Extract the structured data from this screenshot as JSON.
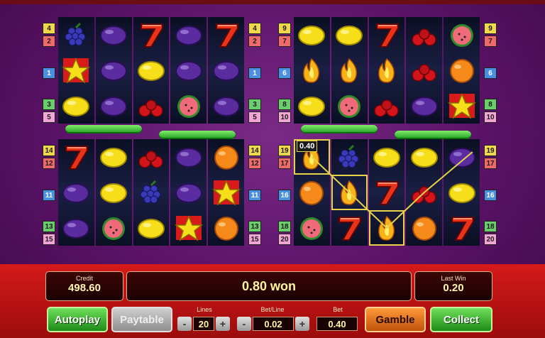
{
  "game": {
    "colors": {
      "background": "#5a1266",
      "bottom_bar": "#c81414",
      "accent_yellow": "#f2e29a"
    },
    "grids": [
      {
        "name": "top-left",
        "left_badges": [
          {
            "value": "4",
            "color": "#f1d84a"
          },
          {
            "value": "2",
            "color": "#f06a6a"
          },
          {
            "value": "1",
            "color": "#4a90e2"
          },
          {
            "value": "3",
            "color": "#6acf6a"
          },
          {
            "value": "5",
            "color": "#f3a6d6"
          }
        ],
        "right_badges": [
          {
            "value": "4",
            "color": "#f1d84a"
          },
          {
            "value": "2",
            "color": "#f06a6a"
          },
          {
            "value": "1",
            "color": "#4a90e2"
          },
          {
            "value": "3",
            "color": "#6acf6a"
          },
          {
            "value": "5",
            "color": "#f3a6d6"
          }
        ],
        "reels": [
          [
            "grapes",
            "star",
            "lemon"
          ],
          [
            "plum",
            "plum",
            "plum"
          ],
          [
            "seven",
            "lemon",
            "cherries"
          ],
          [
            "plum",
            "plum",
            "watermelon"
          ],
          [
            "seven",
            "plum",
            "plum"
          ]
        ]
      },
      {
        "name": "top-right",
        "left_badges": [
          {
            "value": "9",
            "color": "#f1d84a"
          },
          {
            "value": "7",
            "color": "#f06a6a"
          },
          {
            "value": "6",
            "color": "#4a90e2"
          },
          {
            "value": "8",
            "color": "#6acf6a"
          },
          {
            "value": "10",
            "color": "#f3a6d6"
          }
        ],
        "right_badges": [
          {
            "value": "9",
            "color": "#f1d84a"
          },
          {
            "value": "7",
            "color": "#f06a6a"
          },
          {
            "value": "6",
            "color": "#4a90e2"
          },
          {
            "value": "8",
            "color": "#6acf6a"
          },
          {
            "value": "10",
            "color": "#f3a6d6"
          }
        ],
        "reels": [
          [
            "lemon",
            "flame",
            "lemon"
          ],
          [
            "lemon",
            "flame",
            "watermelon"
          ],
          [
            "seven",
            "flame",
            "cherries"
          ],
          [
            "cherries",
            "cherries",
            "plum"
          ],
          [
            "watermelon",
            "orange",
            "star"
          ]
        ]
      },
      {
        "name": "bottom-left",
        "left_badges": [
          {
            "value": "14",
            "color": "#f1d84a"
          },
          {
            "value": "12",
            "color": "#f06a6a"
          },
          {
            "value": "11",
            "color": "#4a90e2"
          },
          {
            "value": "13",
            "color": "#6acf6a"
          },
          {
            "value": "15",
            "color": "#f3a6d6"
          }
        ],
        "right_badges": [
          {
            "value": "14",
            "color": "#f1d84a"
          },
          {
            "value": "12",
            "color": "#f06a6a"
          },
          {
            "value": "11",
            "color": "#4a90e2"
          },
          {
            "value": "13",
            "color": "#6acf6a"
          },
          {
            "value": "15",
            "color": "#f3a6d6"
          }
        ],
        "reels": [
          [
            "seven",
            "plum",
            "plum"
          ],
          [
            "lemon",
            "lemon",
            "watermelon"
          ],
          [
            "cherries",
            "grapes",
            "lemon"
          ],
          [
            "plum",
            "plum",
            "star"
          ],
          [
            "orange",
            "star",
            "orange"
          ]
        ]
      },
      {
        "name": "bottom-right",
        "left_badges": [
          {
            "value": "19",
            "color": "#f1d84a"
          },
          {
            "value": "17",
            "color": "#f06a6a"
          },
          {
            "value": "16",
            "color": "#4a90e2"
          },
          {
            "value": "18",
            "color": "#6acf6a"
          },
          {
            "value": "20",
            "color": "#f3a6d6"
          }
        ],
        "right_badges": [
          {
            "value": "19",
            "color": "#f1d84a"
          },
          {
            "value": "17",
            "color": "#f06a6a"
          },
          {
            "value": "16",
            "color": "#4a90e2"
          },
          {
            "value": "18",
            "color": "#6acf6a"
          },
          {
            "value": "20",
            "color": "#f3a6d6"
          }
        ],
        "reels": [
          [
            "flame",
            "orange",
            "watermelon"
          ],
          [
            "grapes",
            "flame",
            "seven"
          ],
          [
            "lemon",
            "seven",
            "flame"
          ],
          [
            "lemon",
            "cherries",
            "orange"
          ],
          [
            "plum",
            "lemon",
            "seven"
          ]
        ]
      }
    ],
    "win_label": "0.40"
  },
  "panel": {
    "credit_label": "Credit",
    "credit_value": "498.60",
    "message": "0.80 won",
    "last_win_label": "Last Win",
    "last_win_value": "0.20",
    "lines_label": "Lines",
    "lines_value": "20",
    "bet_line_label": "Bet/Line",
    "bet_line_value": "0.02",
    "bet_label": "Bet",
    "bet_value": "0.40",
    "minus": "-",
    "plus": "+",
    "autoplay": "Autoplay",
    "paytable": "Paytable",
    "gamble": "Gamble",
    "collect": "Collect"
  }
}
